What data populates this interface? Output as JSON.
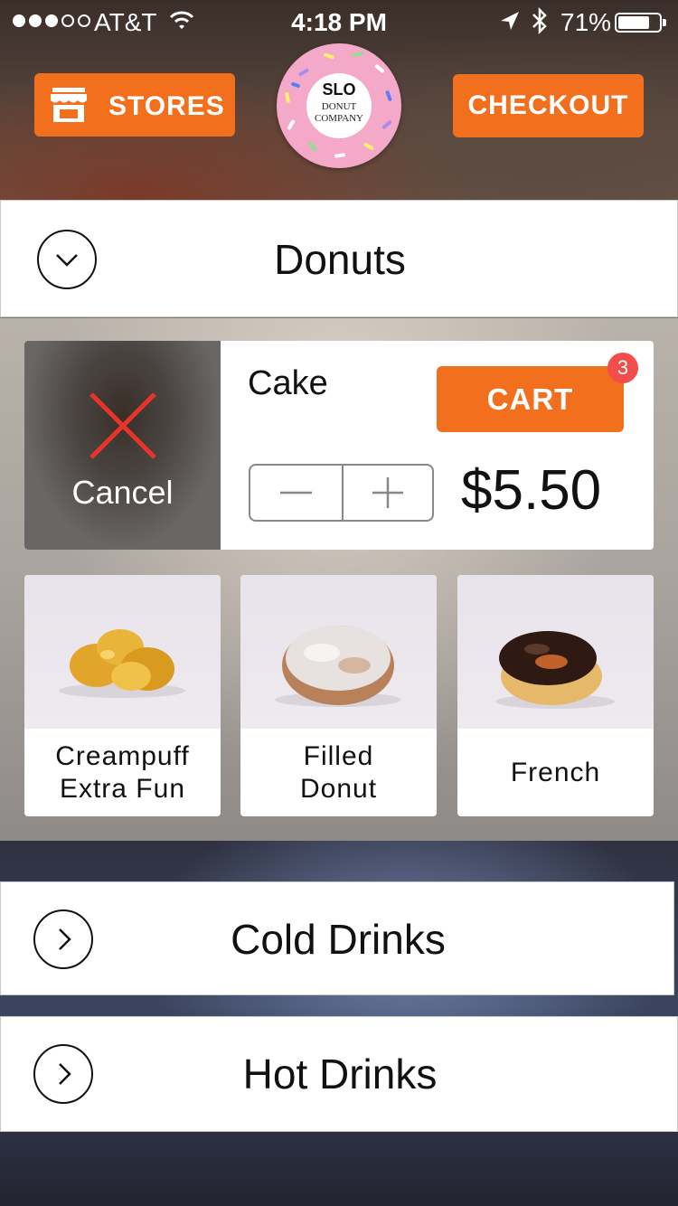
{
  "status_bar": {
    "carrier": "AT&T",
    "time": "4:18 PM",
    "battery_percent": "71%",
    "battery_level": 0.71,
    "signal_bars_filled": 3,
    "signal_bars_total": 5
  },
  "header": {
    "stores_label": "STORES",
    "checkout_label": "CHECKOUT",
    "logo": {
      "line1": "SLO",
      "line2": "DONUT",
      "line3": "COMPANY"
    }
  },
  "categories": [
    {
      "label": "Donuts",
      "expanded": true
    },
    {
      "label": "Cold Drinks",
      "expanded": false
    },
    {
      "label": "Hot Drinks",
      "expanded": false
    }
  ],
  "selected_item": {
    "cancel_label": "Cancel",
    "name": "Cake",
    "cart_label": "CART",
    "cart_count": "3",
    "price": "$5.50"
  },
  "products": [
    {
      "name": "Creampuff\nExtra Fun"
    },
    {
      "name": "Filled\nDonut"
    },
    {
      "name": "French"
    }
  ],
  "colors": {
    "accent": "#f26f1e",
    "badge": "#f24c4c",
    "cancel_x": "#e8352a"
  },
  "icons": {
    "stores": "storefront-icon",
    "collapse": "chevron-down-icon",
    "expand": "chevron-right-icon",
    "cancel": "close-icon",
    "decrement": "minus-icon",
    "increment": "plus-icon"
  }
}
